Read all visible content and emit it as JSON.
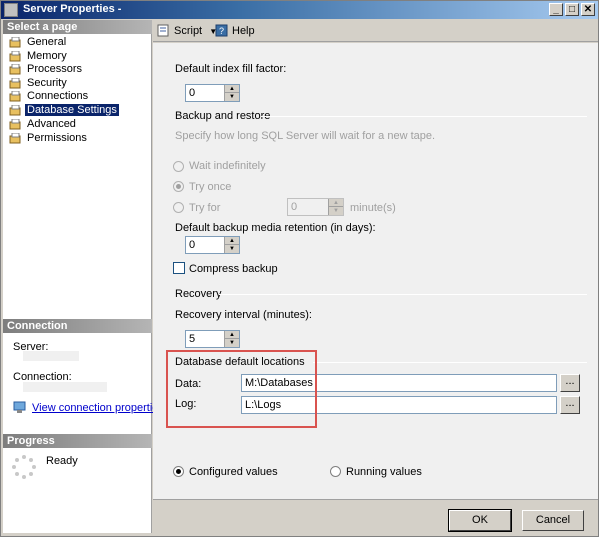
{
  "window": {
    "title": "Server Properties -"
  },
  "sidebar": {
    "select_page_header": "Select a page",
    "items": [
      {
        "label": "General"
      },
      {
        "label": "Memory"
      },
      {
        "label": "Processors"
      },
      {
        "label": "Security"
      },
      {
        "label": "Connections"
      },
      {
        "label": "Database Settings",
        "selected": true
      },
      {
        "label": "Advanced"
      },
      {
        "label": "Permissions"
      }
    ],
    "connection_header": "Connection",
    "server_label": "Server:",
    "connection_label": "Connection:",
    "view_connection_link": "View connection properties",
    "progress_header": "Progress",
    "progress_status": "Ready"
  },
  "toolbar": {
    "script_label": "Script",
    "help_label": "Help"
  },
  "settings": {
    "fill_factor_label": "Default index fill factor:",
    "fill_factor_value": "0",
    "backup_group": "Backup and restore",
    "backup_desc": "Specify how long SQL Server will wait for a new tape.",
    "wait_indefinitely": "Wait indefinitely",
    "try_once": "Try once",
    "try_for": "Try for",
    "try_for_value": "0",
    "minutes_label": "minute(s)",
    "retention_label": "Default backup media retention (in days):",
    "retention_value": "0",
    "compress_label": "Compress backup",
    "recovery_group": "Recovery",
    "recovery_interval_label": "Recovery interval (minutes):",
    "recovery_interval_value": "5",
    "locations_group": "Database default locations",
    "data_label": "Data:",
    "data_value": "M:\\Databases",
    "log_label": "Log:",
    "log_value": "L:\\Logs",
    "browse_label": "...",
    "configured_values": "Configured values",
    "running_values": "Running values"
  },
  "buttons": {
    "ok": "OK",
    "cancel": "Cancel"
  },
  "colors": {
    "highlight_box": "#d9534f",
    "selected_nav": "#0a246a"
  }
}
